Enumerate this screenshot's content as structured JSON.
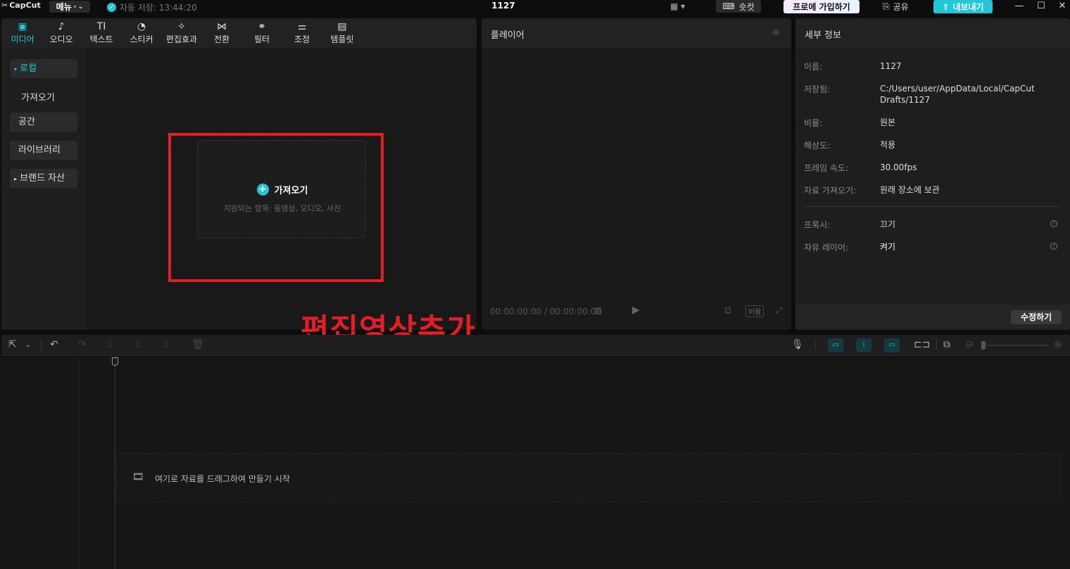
{
  "app": {
    "logo": "CapCut",
    "menu_label": "메뉴",
    "autosave": "자동 저장: 13:44:20",
    "project_title": "1127",
    "shortcut_label": "숏컷",
    "pro_label": "프로에 가입하기",
    "share_label": "공유",
    "export_label": "내보내기",
    "accent_color": "#21c7d6",
    "highlight_color": "#e41e26"
  },
  "tabs": [
    {
      "label": "미디어",
      "icon": "media-icon",
      "glyph": "▣"
    },
    {
      "label": "오디오",
      "icon": "audio-icon",
      "glyph": "♪"
    },
    {
      "label": "텍스트",
      "icon": "text-icon",
      "glyph": "TI"
    },
    {
      "label": "스티커",
      "icon": "sticker-icon",
      "glyph": "◔"
    },
    {
      "label": "편집효과",
      "icon": "effects-icon",
      "glyph": "✧"
    },
    {
      "label": "전환",
      "icon": "transition-icon",
      "glyph": "⋈"
    },
    {
      "label": "필터",
      "icon": "filter-icon",
      "glyph": "⚭"
    },
    {
      "label": "조정",
      "icon": "adjust-icon",
      "glyph": "⚌"
    },
    {
      "label": "템플릿",
      "icon": "template-icon",
      "glyph": "▤"
    }
  ],
  "sidebar": {
    "local": "로컬",
    "import": "가져오기",
    "space": "공간",
    "library": "라이브러리",
    "brand": "브랜드 자산"
  },
  "dropzone": {
    "import_label": "가져오기",
    "supported": "지원되는 항목: 동영상, 오디오, 사진"
  },
  "player": {
    "title": "플레이어",
    "timecode": "00:00:00:00 / 00:00:00:00",
    "ratio_label": "비율"
  },
  "details": {
    "title": "세부 정보",
    "rows": [
      {
        "label": "이름:",
        "value": "1127"
      },
      {
        "label": "저장됨:",
        "value": "C:/Users/user/AppData/Local/CapCut Drafts/1127"
      },
      {
        "label": "비율:",
        "value": "원본"
      },
      {
        "label": "해상도:",
        "value": "적용"
      },
      {
        "label": "프레임 속도:",
        "value": "30.00fps"
      },
      {
        "label": "자료 가져오기:",
        "value": "원래 장소에 보관"
      }
    ],
    "proxy_label": "프록시:",
    "proxy_value": "끄기",
    "free_layer_label": "자유 레이어:",
    "free_layer_value": "켜기",
    "edit_button": "수정하기"
  },
  "overlay_caption": "편집영상추가",
  "timeline": {
    "drop_text": "여기로 자료를 드래그하여 만들기 시작"
  }
}
